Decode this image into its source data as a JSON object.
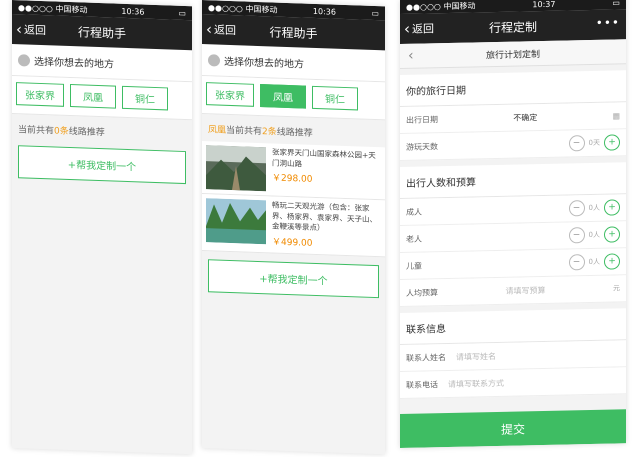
{
  "colors": {
    "accent": "#3ebd63",
    "price": "#f08a00",
    "highlight": "#f0a020",
    "navbar": "#222222"
  },
  "screen1": {
    "status": {
      "carrier": "●●○○○ 中国移动",
      "time": "10:36"
    },
    "nav": {
      "back": "返回",
      "title": "行程助手"
    },
    "prompt": "选择你想去的地方",
    "tabs": [
      "张家界",
      "凤凰",
      "铜仁"
    ],
    "summary": {
      "prefix": "当前共有",
      "count": "0条",
      "suffix": "线路推荐"
    },
    "custom_button": "+帮我定制一个"
  },
  "screen2": {
    "status": {
      "carrier": "●●○○○ 中国移动",
      "time": "10:36"
    },
    "nav": {
      "back": "返回",
      "title": "行程助手"
    },
    "prompt": "选择你想去的地方",
    "tabs": [
      "张家界",
      "凤凰",
      "铜仁"
    ],
    "summary": {
      "place": "凤凰",
      "prefix": "当前共有",
      "count": "2条",
      "suffix": "线路推荐"
    },
    "routes": [
      {
        "title": "张家界天门山国家森林公园+天门洞山路",
        "price": "￥298.00"
      },
      {
        "title": "畅玩二天观光游（包含：张家界、杨家界、袁家界、天子山、金鞭溪等景点）",
        "price": "￥499.00"
      }
    ],
    "custom_button": "+帮我定制一个"
  },
  "screen3": {
    "status": {
      "carrier": "●●○○○ 中国移动",
      "time": "10:37"
    },
    "nav": {
      "back": "返回",
      "title": "行程定制",
      "more": "•••"
    },
    "subnav_title": "旅行计划定制",
    "dates_section": "你的旅行日期",
    "date_label": "出行日期",
    "date_value": "不确定",
    "days_label": "游玩天数",
    "days_unit": "0天",
    "people_section": "出行人数和预算",
    "adults_label": "成人",
    "elders_label": "老人",
    "children_label": "儿童",
    "people_unit": "0人",
    "budget_label": "人均预算",
    "budget_placeholder": "请填写预算",
    "budget_unit": "元",
    "contact_section": "联系信息",
    "name_label": "联系人姓名",
    "name_placeholder": "请填写姓名",
    "phone_label": "联系电话",
    "phone_placeholder": "请填写联系方式",
    "submit": "提交"
  }
}
